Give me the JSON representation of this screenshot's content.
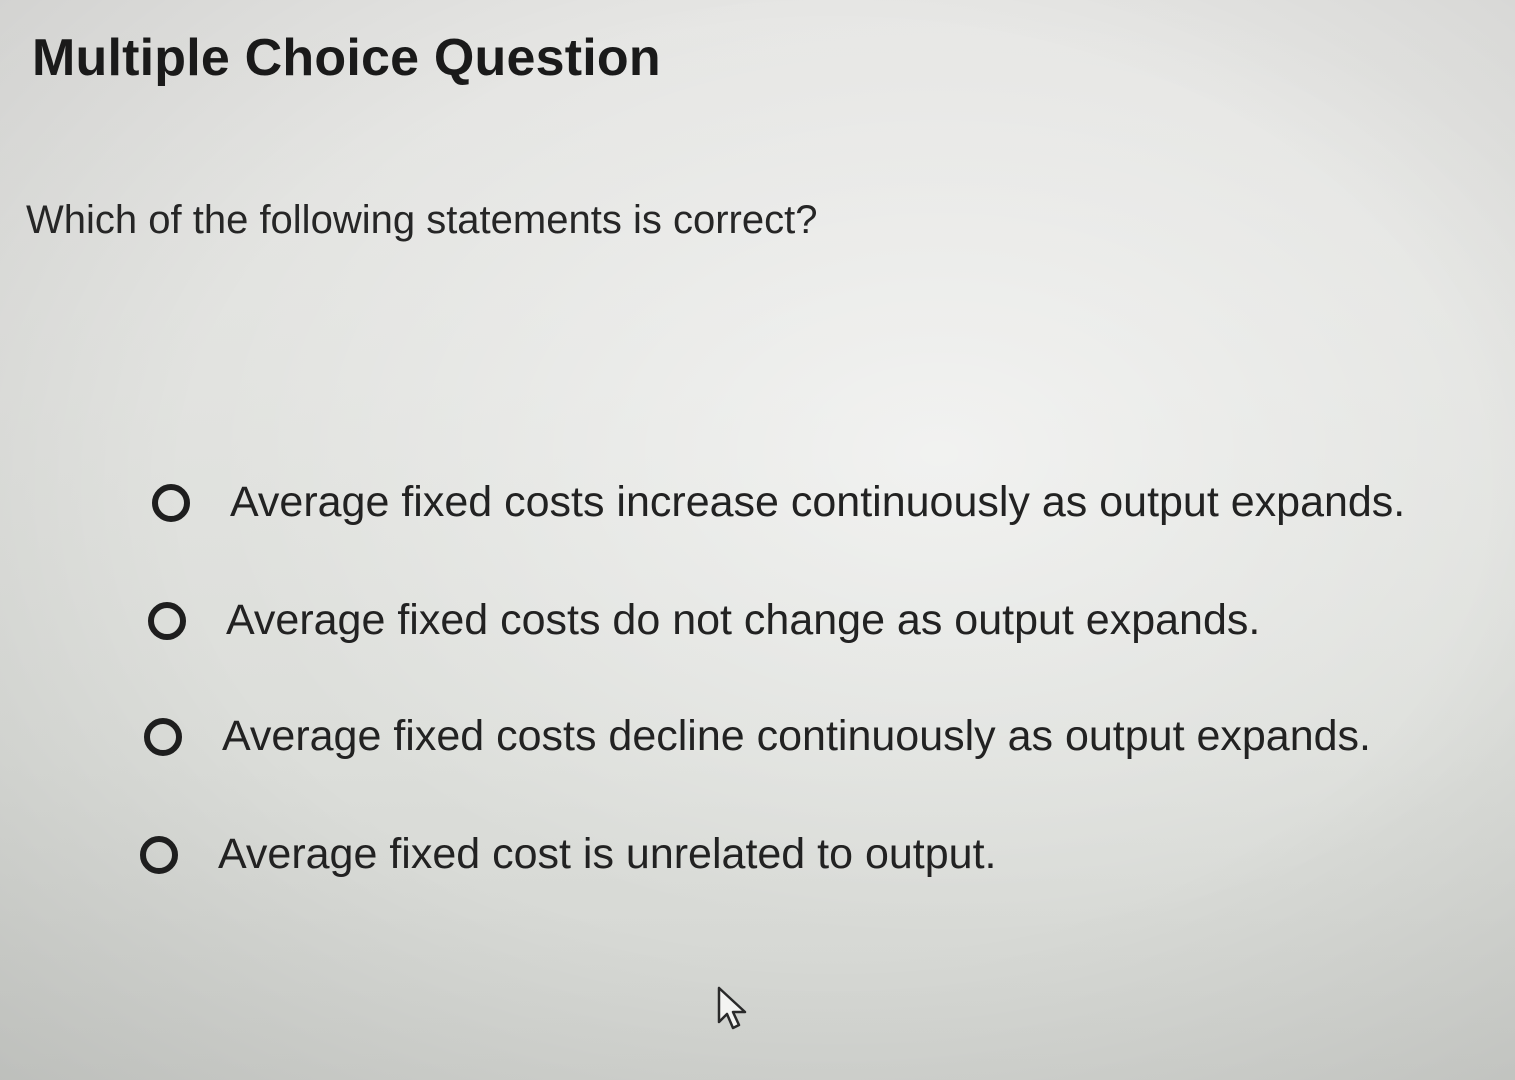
{
  "question": {
    "heading": "Multiple Choice Question",
    "prompt": "Which of the following statements is correct?"
  },
  "options": [
    {
      "label": "Average fixed costs increase continuously as output expands.",
      "selected": false
    },
    {
      "label": "Average fixed costs do not change as output expands.",
      "selected": false
    },
    {
      "label": "Average fixed costs decline continuously as output expands.",
      "selected": false
    },
    {
      "label": "Average fixed cost is unrelated to output.",
      "selected": false
    }
  ],
  "icons": {
    "radio": "radio-button-icon",
    "cursor": "mouse-pointer-icon"
  },
  "colors": {
    "text": "#1f1f1f",
    "background": "#e2e3e0"
  }
}
